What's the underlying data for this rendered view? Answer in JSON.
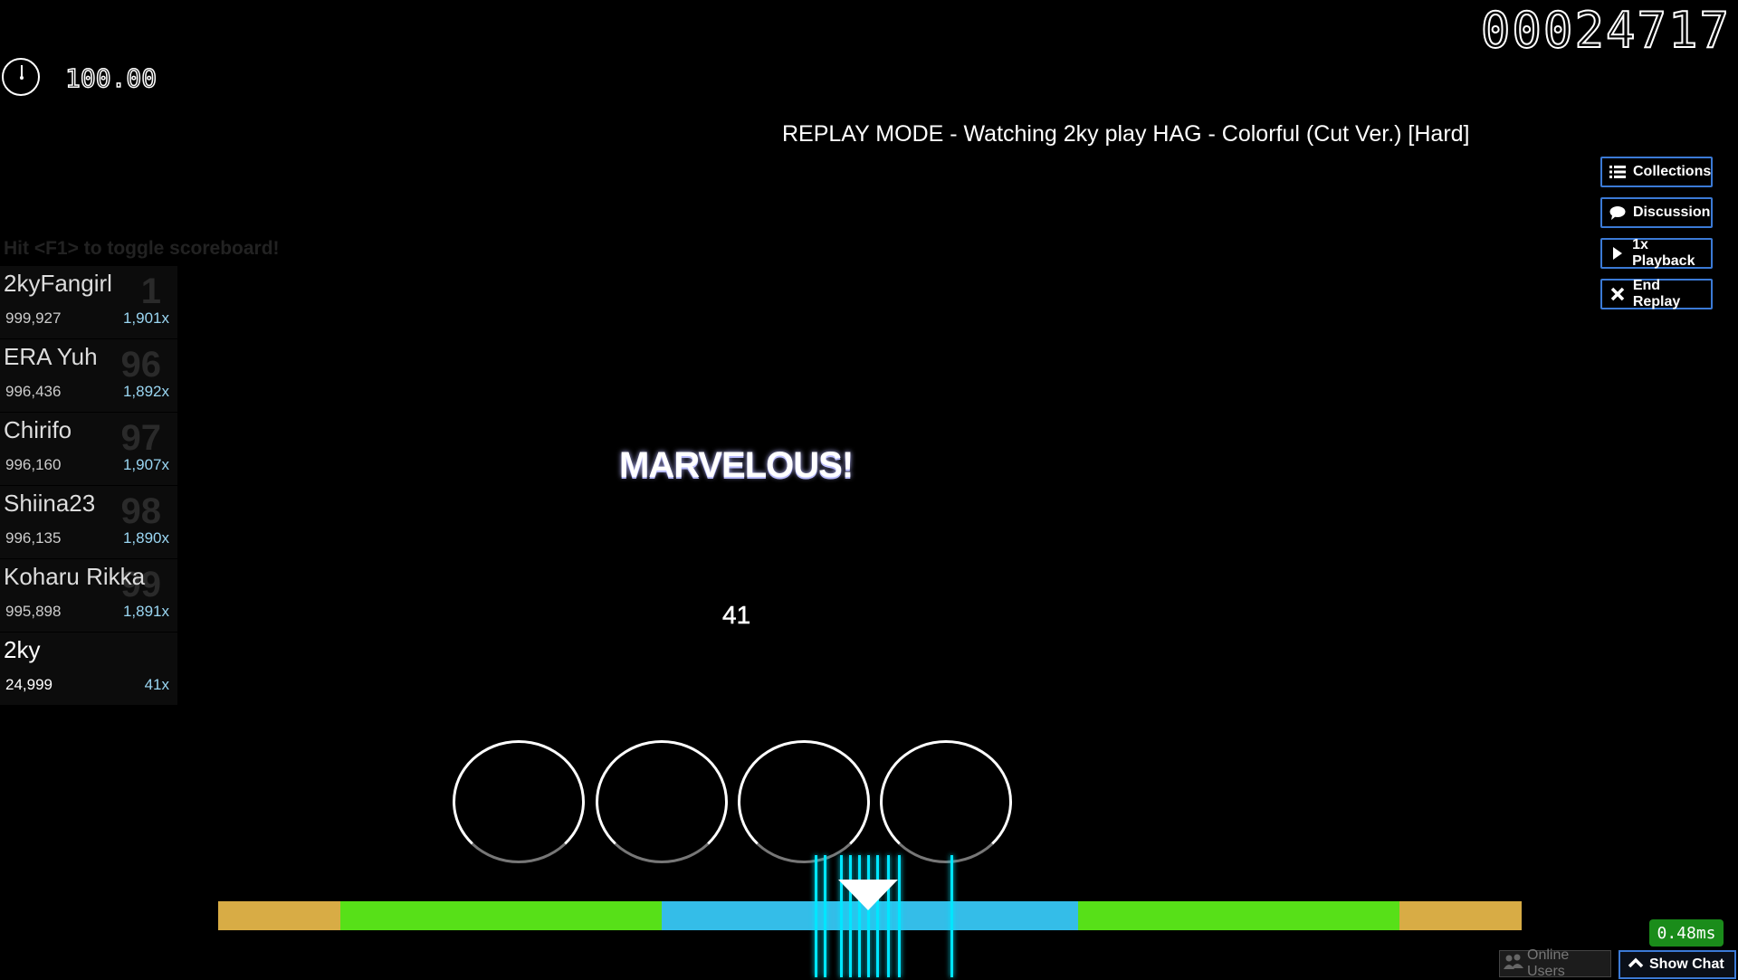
{
  "score": "00024717",
  "accuracy_display": "100.00",
  "replay_title": "REPLAY MODE - Watching 2ky play HAG - Colorful (Cut Ver.) [Hard]",
  "side_buttons": [
    {
      "label": "Collections",
      "icon": "list-icon"
    },
    {
      "label": "Discussion",
      "icon": "chat-bubble-icon"
    },
    {
      "label": "1x Playback",
      "icon": "play-icon"
    },
    {
      "label": "End Replay",
      "icon": "close-icon"
    }
  ],
  "scoreboard": {
    "hint": "Hit <F1> to toggle scoreboard!",
    "entries": [
      {
        "rank": "1",
        "name": "2kyFangirl",
        "score": "999,927",
        "combo": "1,901x"
      },
      {
        "rank": "96",
        "name": "ERA Yuh",
        "score": "996,436",
        "combo": "1,892x"
      },
      {
        "rank": "97",
        "name": "Chirifo",
        "score": "996,160",
        "combo": "1,907x"
      },
      {
        "rank": "98",
        "name": "Shiina23",
        "score": "996,135",
        "combo": "1,890x"
      },
      {
        "rank": "99",
        "name": "Koharu Rikka",
        "score": "995,898",
        "combo": "1,891x"
      },
      {
        "rank": "",
        "name": "2ky",
        "score": "24,999",
        "combo": "41x"
      }
    ]
  },
  "judgement": "MARVELOUS!",
  "combo": "41",
  "hit_error_colors": {
    "outer": "#d8ac45",
    "middle": "#57e018",
    "inner": "#34bde8"
  },
  "latency": "0.48ms",
  "bottom": {
    "online_users": "Online Users",
    "show_chat": "Show Chat"
  }
}
